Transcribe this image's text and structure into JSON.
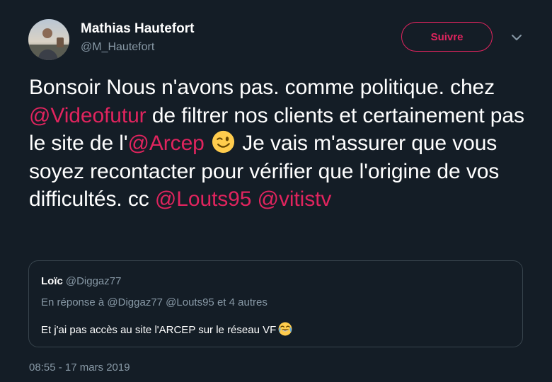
{
  "author": {
    "name": "Mathias Hautefort",
    "handle": "@M_Hautefort"
  },
  "follow_label": "Suivre",
  "icons": {
    "menu": "chevron-down-icon",
    "emoji_in_text": "winking-face-emoji",
    "emoji_in_quote": "face-with-tears-of-joy-emoji"
  },
  "colors": {
    "background": "#141d26",
    "accent": "#e0245e",
    "secondary_text": "#8899a6",
    "border": "#38444d"
  },
  "tweet": {
    "seg1": "Bonsoir Nous n'avons pas. comme politique. chez ",
    "mention1": "@Videofutur",
    "seg2": " de filtrer nos clients et certainement pas le site de l'",
    "mention2": "@Arcep",
    "seg3": " Je vais m'assurer que vous soyez recontacter pour vérifier que l'origine de vos difficultés. cc ",
    "mention3": "@Louts95",
    "mention4": "@vitistv"
  },
  "quote": {
    "author_name": "Loïc",
    "author_handle": "@Diggaz77",
    "reply_context": "En réponse à @Diggaz77 @Louts95 et 4 autres",
    "text": "Et j'ai pas accès au site l'ARCEP sur le réseau VF"
  },
  "timestamp": "08:55 - 17 mars 2019"
}
